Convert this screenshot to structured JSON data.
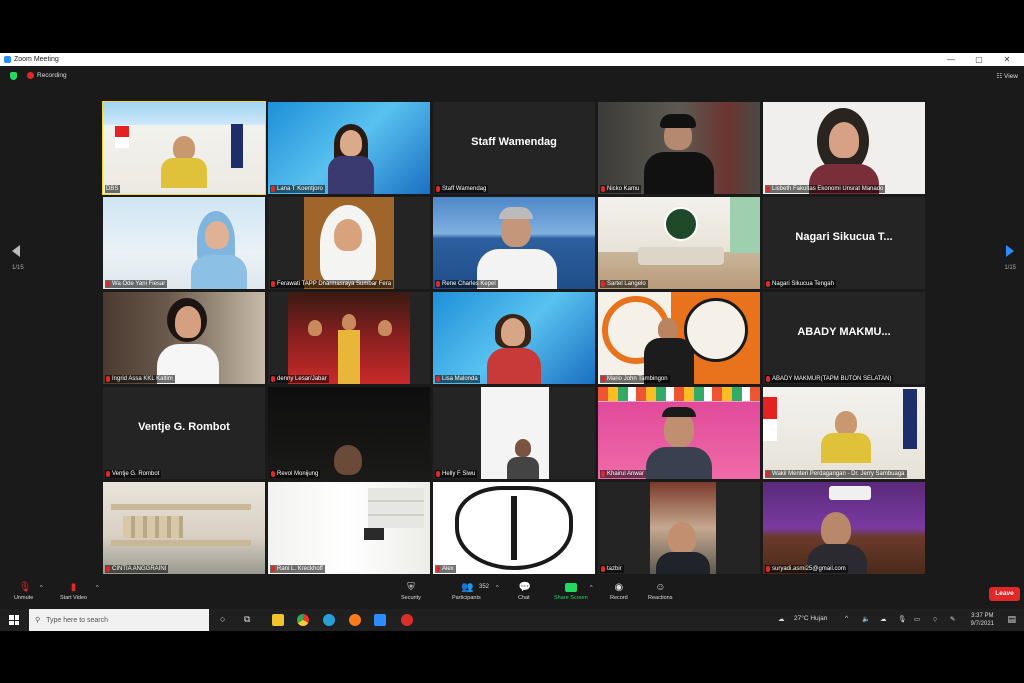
{
  "window": {
    "title": "Zoom Meeting",
    "minimize": "—",
    "maximize": "▢",
    "close": "✕"
  },
  "meeting": {
    "recording_label": "Recording",
    "view_label": "View",
    "page_left": "1/15",
    "page_right": "1/15"
  },
  "tiles": [
    {
      "name": "DBS",
      "muted": false,
      "active": true
    },
    {
      "name": "Lana T Koentjoro",
      "muted": true
    },
    {
      "name": "Staff Wamendag",
      "muted": true,
      "display_text": "Staff Wamendag"
    },
    {
      "name": "Nicko Kamu",
      "muted": true
    },
    {
      "name": "Lisbeth Fakultas Ekonomi Unsrat Manado",
      "muted": true
    },
    {
      "name": "Wa Ode Yani Fiesar",
      "muted": true
    },
    {
      "name": "Ferawati TAPP Dharmasraya Sumbar Fera",
      "muted": true
    },
    {
      "name": "Rene Charles Kepel",
      "muted": true
    },
    {
      "name": "Sartel Langelo",
      "muted": true
    },
    {
      "name": "Nagari Sikucua Tengah",
      "muted": true,
      "display_text": "Nagari Sikucua T..."
    },
    {
      "name": "Ingrid Assa KKL Kaltim",
      "muted": true
    },
    {
      "name": "denny Lesar/Jabar",
      "muted": true
    },
    {
      "name": "Lisa Malonda",
      "muted": true
    },
    {
      "name": "Mario John Tambingon",
      "muted": true
    },
    {
      "name": "ABADY MAKMUR(TAPM BUTON SELATAN)",
      "muted": true,
      "display_text": "ABADY MAKMU..."
    },
    {
      "name": "Ventje G. Rombot",
      "muted": true,
      "display_text": "Ventje G. Rombot"
    },
    {
      "name": "Revol Monijung",
      "muted": true
    },
    {
      "name": "Helly F Siwu",
      "muted": true
    },
    {
      "name": "Khairul Anwar",
      "muted": true
    },
    {
      "name": "Wakil Menteri Perdagangan - Dr. Jerry Sambuaga",
      "muted": true
    },
    {
      "name": "CINTIA ANGGRAINI",
      "muted": true
    },
    {
      "name": "Rani L. Kreckhoff",
      "muted": true
    },
    {
      "name": "Alex",
      "muted": true
    },
    {
      "name": "tazbir",
      "muted": true
    },
    {
      "name": "suryadi.asmi25@gmail.com",
      "muted": true
    }
  ],
  "toolbar": {
    "unmute": "Unmute",
    "start_video": "Start Video",
    "security": "Security",
    "participants": "Participants",
    "participants_count": "352",
    "chat": "Chat",
    "share_screen": "Share Screen",
    "record": "Record",
    "reactions": "Reactions",
    "leave": "Leave"
  },
  "taskbar": {
    "search_placeholder": "Type here to search",
    "weather": "27°C  Hujan",
    "time": "3:37 PM",
    "date": "9/7/2021"
  },
  "colors": {
    "accent": "#2d8cff",
    "share_green": "#23d962",
    "leave_red": "#e02828",
    "active_speaker": "#f3d82b"
  }
}
